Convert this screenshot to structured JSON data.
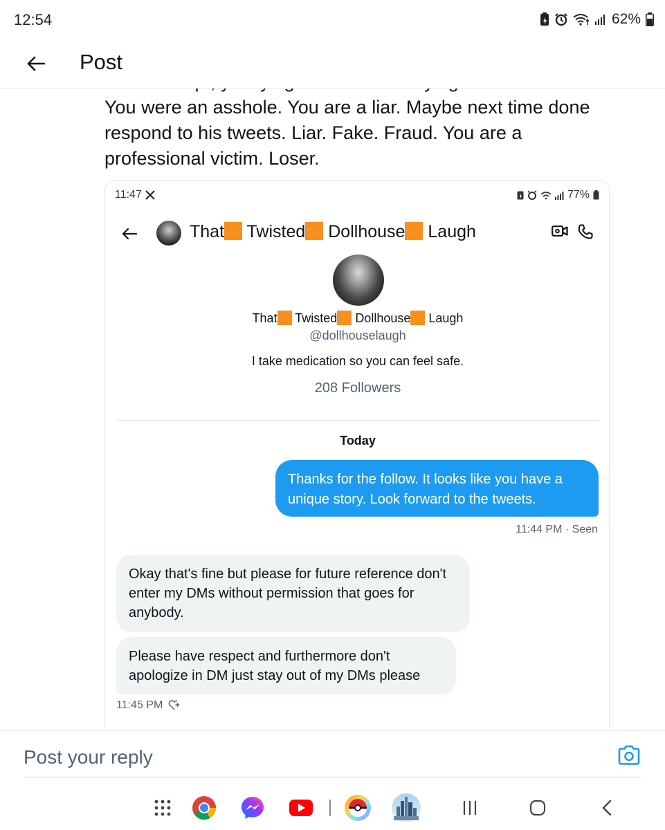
{
  "status_bar": {
    "time": "12:54",
    "battery": "62%"
  },
  "header": {
    "title": "Post"
  },
  "post": {
    "text": "is the receipt, you lying cunt. He was trying to make a friend. You were an asshole. You are a liar. Maybe next time done respond to his tweets. Liar. Fake. Fraud. You are a professional victim. Loser."
  },
  "embed": {
    "status_time": "11:47",
    "status_battery": "77%",
    "header_name_parts": [
      "That",
      "Twisted",
      "Dollhouse",
      "Laugh"
    ],
    "profile": {
      "name_parts": [
        "That",
        "Twisted",
        "Dollhouse",
        "Laugh"
      ],
      "handle": "@dollhouselaugh",
      "bio": "I take medication so you can feel safe.",
      "followers": "208 Followers"
    },
    "date_separator": "Today",
    "messages": [
      {
        "direction": "out",
        "text": "Thanks for the follow. It looks like you have a unique story. Look forward to the tweets."
      },
      {
        "direction": "in",
        "text": "Okay that's fine but please for future reference don't enter my DMs without permission that goes for anybody."
      },
      {
        "direction": "in",
        "text": "Please have respect and furthermore don't apologize in DM just stay out of my DMs please"
      }
    ],
    "out_meta": "11:44 PM · Seen",
    "in_meta": "11:45 PM"
  },
  "reply": {
    "placeholder": "Post your reply"
  },
  "colors": {
    "accent": "#1d9bf0",
    "emoji_square": "#f7901e",
    "bubble_in": "#eff3f4"
  },
  "nav_bar": {
    "icons": [
      "app-drawer-icon",
      "chrome-icon",
      "messenger-icon",
      "youtube-icon",
      "pokemon-go-icon",
      "city-app-icon",
      "recents-icon",
      "home-icon",
      "back-icon"
    ]
  }
}
